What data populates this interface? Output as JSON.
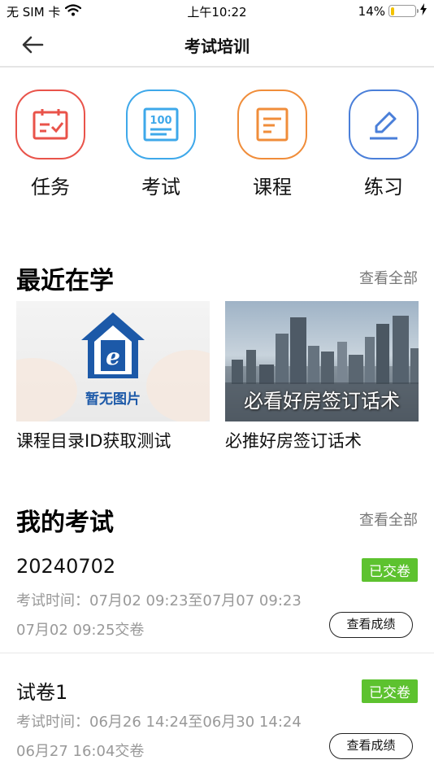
{
  "status_bar": {
    "carrier": "无 SIM 卡",
    "time": "上午10:22",
    "battery_percent": "14%",
    "battery_level": 0.14,
    "battery_color": "#f2c200"
  },
  "nav": {
    "title": "考试培训",
    "back_icon": "arrow-left-icon"
  },
  "quick_menu": [
    {
      "label": "任务",
      "icon": "calendar-check-icon",
      "color": "#e9534a"
    },
    {
      "label": "考试",
      "icon": "score-100-icon",
      "color": "#3ea8ea"
    },
    {
      "label": "课程",
      "icon": "document-icon",
      "color": "#f08d3a"
    },
    {
      "label": "练习",
      "icon": "pencil-icon",
      "color": "#4a7fd9"
    }
  ],
  "recent": {
    "title": "最近在学",
    "more": "查看全部",
    "courses": [
      {
        "name": "课程目录ID获取测试",
        "thumb_text": "暂无图片"
      },
      {
        "name": "必推好房签订话术",
        "thumb_text": "必看好房签订话术"
      }
    ]
  },
  "exams": {
    "title": "我的考试",
    "more": "查看全部",
    "items": [
      {
        "name": "20240702",
        "status": "已交卷",
        "time": "考试时间：07月02 09:23至07月07 09:23",
        "submitted": "07月02 09:25交卷",
        "action": "查看成绩"
      },
      {
        "name": "试卷1",
        "status": "已交卷",
        "time": "考试时间：06月26 14:24至06月30 14:24",
        "submitted": "06月27 16:04交卷",
        "action": "查看成绩"
      }
    ]
  },
  "colors": {
    "badge_green": "#5dc22f",
    "muted_text": "#999999"
  }
}
